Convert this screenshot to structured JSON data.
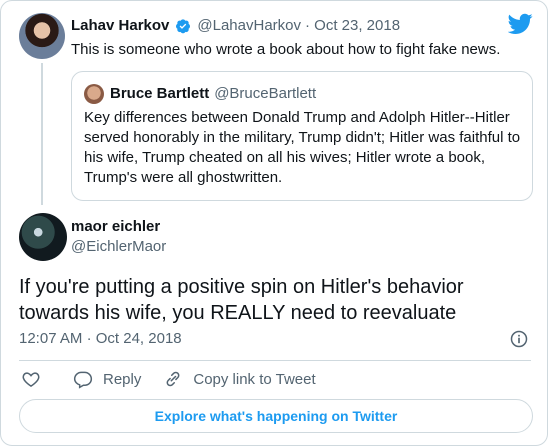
{
  "colors": {
    "accent": "#1d9bf0",
    "secondary_text": "#536471",
    "border": "#cfd9de"
  },
  "parent_tweet": {
    "author_name": "Lahav Harkov",
    "verified_icon": "verified-badge-icon",
    "handle": "@LahavHarkov",
    "date": "· Oct 23, 2018",
    "text": "This is someone who wrote a book about how to fight fake news."
  },
  "quoted_tweet": {
    "author_name": "Bruce Bartlett",
    "handle": "@BruceBartlett",
    "text": "Key differences between Donald Trump and Adolph Hitler--Hitler served honorably in the military, Trump didn't; Hitler was faithful to his wife, Trump cheated on all his wives; Hitler wrote a book, Trump's were all ghostwritten."
  },
  "main_tweet": {
    "author_name": "maor eichler",
    "handle": "@EichlerMaor",
    "text": "If you're putting a positive spin on Hitler's behavior towards his wife, you REALLY need to reevaluate",
    "time": "12:07 AM",
    "date": "Oct 24, 2018"
  },
  "actions": {
    "like_icon": "heart-icon",
    "reply_label": "Reply",
    "copy_link_label": "Copy link to Tweet"
  },
  "footer": {
    "explore_label": "Explore what's happening on Twitter"
  }
}
